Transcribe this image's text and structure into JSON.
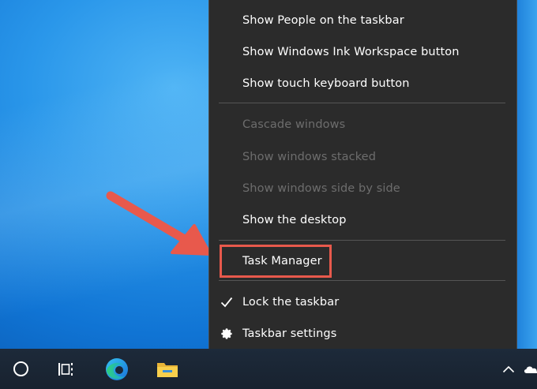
{
  "context_menu": {
    "items": [
      {
        "label": "Show People on the taskbar",
        "enabled": true
      },
      {
        "label": "Show Windows Ink Workspace button",
        "enabled": true
      },
      {
        "label": "Show touch keyboard button",
        "enabled": true
      },
      {
        "label": "Cascade windows",
        "enabled": false
      },
      {
        "label": "Show windows stacked",
        "enabled": false
      },
      {
        "label": "Show windows side by side",
        "enabled": false
      },
      {
        "label": "Show the desktop",
        "enabled": true
      },
      {
        "label": "Task Manager",
        "enabled": true,
        "highlighted": true
      },
      {
        "label": "Lock the taskbar",
        "enabled": true,
        "checked": true
      },
      {
        "label": "Taskbar settings",
        "enabled": true,
        "icon": "gear-icon"
      }
    ]
  },
  "taskbar": {
    "icons": [
      "search-icon",
      "task-view-icon",
      "edge-icon",
      "file-explorer-icon"
    ],
    "tray_icons": [
      "chevron-up-icon",
      "onedrive-cloud-icon"
    ]
  },
  "colors": {
    "menu_background": "#2b2b2b",
    "menu_text": "#ffffff",
    "menu_disabled_text": "#6d6d6d",
    "annotation_red": "#e8594c",
    "taskbar": "#1b2838",
    "desktop_blue": "#1074d4"
  },
  "annotation": {
    "arrow_icon": "arrow-pointer-annotation",
    "highlight_target": "Task Manager"
  }
}
